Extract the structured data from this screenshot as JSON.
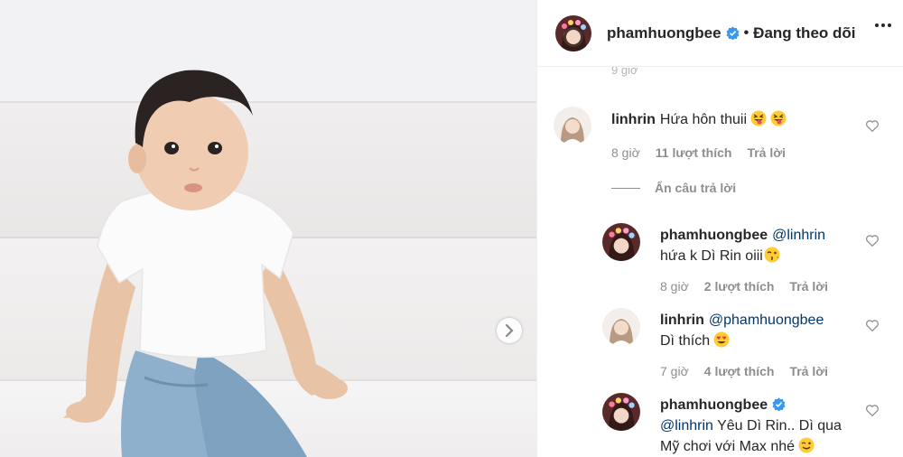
{
  "post": {
    "username": "phamhuongbee",
    "separator": "•",
    "follow_status": "Đang theo dõi",
    "faded_time": "9 giờ"
  },
  "comments": [
    {
      "username": "linhrin",
      "text": "Hứa hôn thuii",
      "emoji": [
        "squinting-tongue-emoji",
        "squinting-tongue-emoji"
      ],
      "time": "8 giờ",
      "likes": "11 lượt thích",
      "reply": "Trả lời"
    }
  ],
  "hide_replies": "Ẩn câu trả lời",
  "replies": [
    {
      "username": "phamhuongbee",
      "mention": "@linhrin",
      "text": "hứa k Dì Rin oiii",
      "emoji": "kissing-wink-emoji",
      "time": "8 giờ",
      "likes": "2 lượt thích",
      "reply": "Trả lời"
    },
    {
      "username": "linhrin",
      "mention": "@phamhuongbee",
      "text": "Dì thích",
      "emoji": "heart-eyes-emoji",
      "time": "7 giờ",
      "likes": "4 lượt thích",
      "reply": "Trả lời"
    },
    {
      "username": "phamhuongbee",
      "verified": true,
      "mention": "@linhrin",
      "text": "Yêu Dì Rin.. Dì qua",
      "text2": "Mỹ chơi với Max nhé",
      "emoji": "wink-emoji"
    }
  ],
  "colors": {
    "verified_blue": "#3897f0",
    "mention": "#00376b",
    "muted": "#8e8e8e",
    "emoji_yellow": "#ffcc33"
  }
}
